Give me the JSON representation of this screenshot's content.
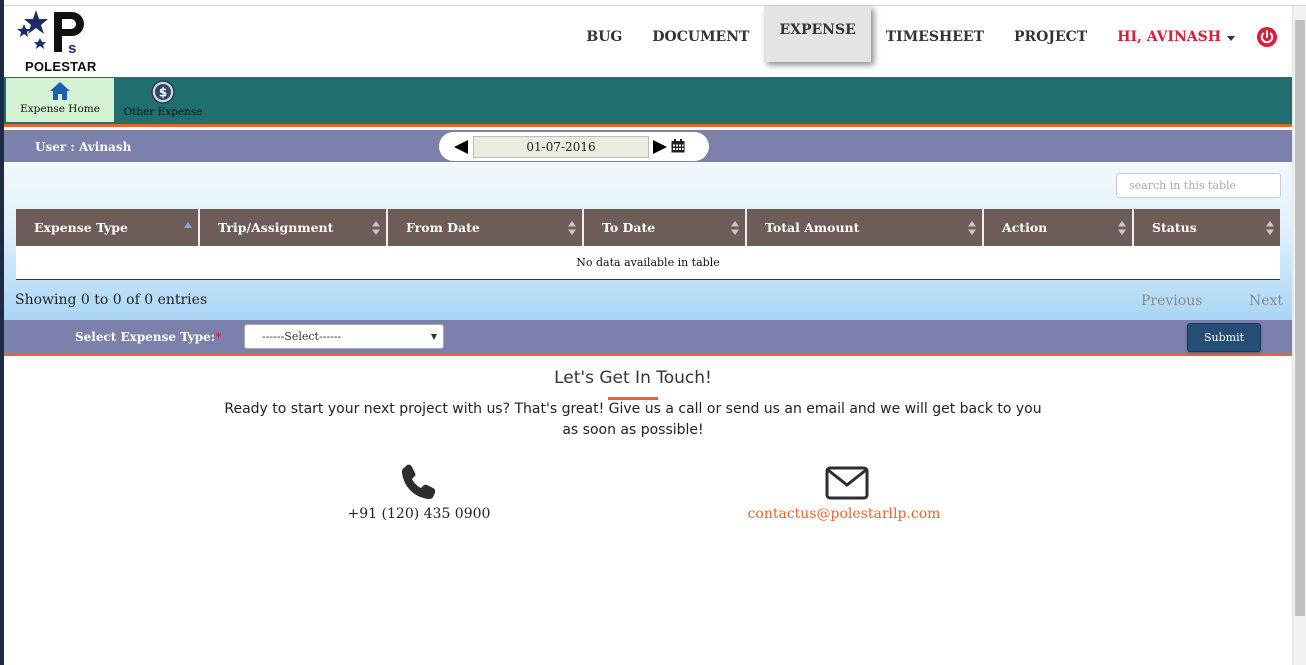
{
  "brand": {
    "name": "POLESTAR"
  },
  "nav": {
    "items": [
      {
        "label": "BUG"
      },
      {
        "label": "DOCUMENT"
      },
      {
        "label": "EXPENSE",
        "active": true
      },
      {
        "label": "TIMESHEET"
      },
      {
        "label": "PROJECT"
      }
    ],
    "user_greeting": "HI, AVINASH",
    "power_icon": "power-icon"
  },
  "toolbar": {
    "home_label": "Expense Home",
    "other_label": "Other Expense",
    "home_icon": "home-icon",
    "other_icon": "dollar-coin-icon"
  },
  "userbar": {
    "user_label": "User : Avinash",
    "date_value": "01-07-2016"
  },
  "table": {
    "search_placeholder": "search in this table",
    "columns": [
      "Expense Type",
      "Trip/Assignment",
      "From Date",
      "To Date",
      "Total Amount",
      "Action",
      "Status"
    ],
    "empty_message": "No data available in table",
    "info": "Showing 0 to 0 of 0 entries",
    "previous": "Previous",
    "next": "Next"
  },
  "expense_select": {
    "label": "Select Expense Type:",
    "required_mark": "*",
    "selected": "------Select------",
    "submit_label": "Submit"
  },
  "contact": {
    "title": "Let's Get In Touch!",
    "text": "Ready to start your next project with us? That's great! Give us a call or send us an email and we will get back to you as soon as possible!",
    "phone": "+91 (120) 435 0900",
    "email": "contactus@polestarllp.com"
  },
  "colors": {
    "teal": "#1f6e70",
    "accent_orange": "#e8642c",
    "bar_purple": "#7b81aa",
    "header_brown": "#6e5c59",
    "user_red": "#d81e3a",
    "submit_blue": "#244e78"
  }
}
